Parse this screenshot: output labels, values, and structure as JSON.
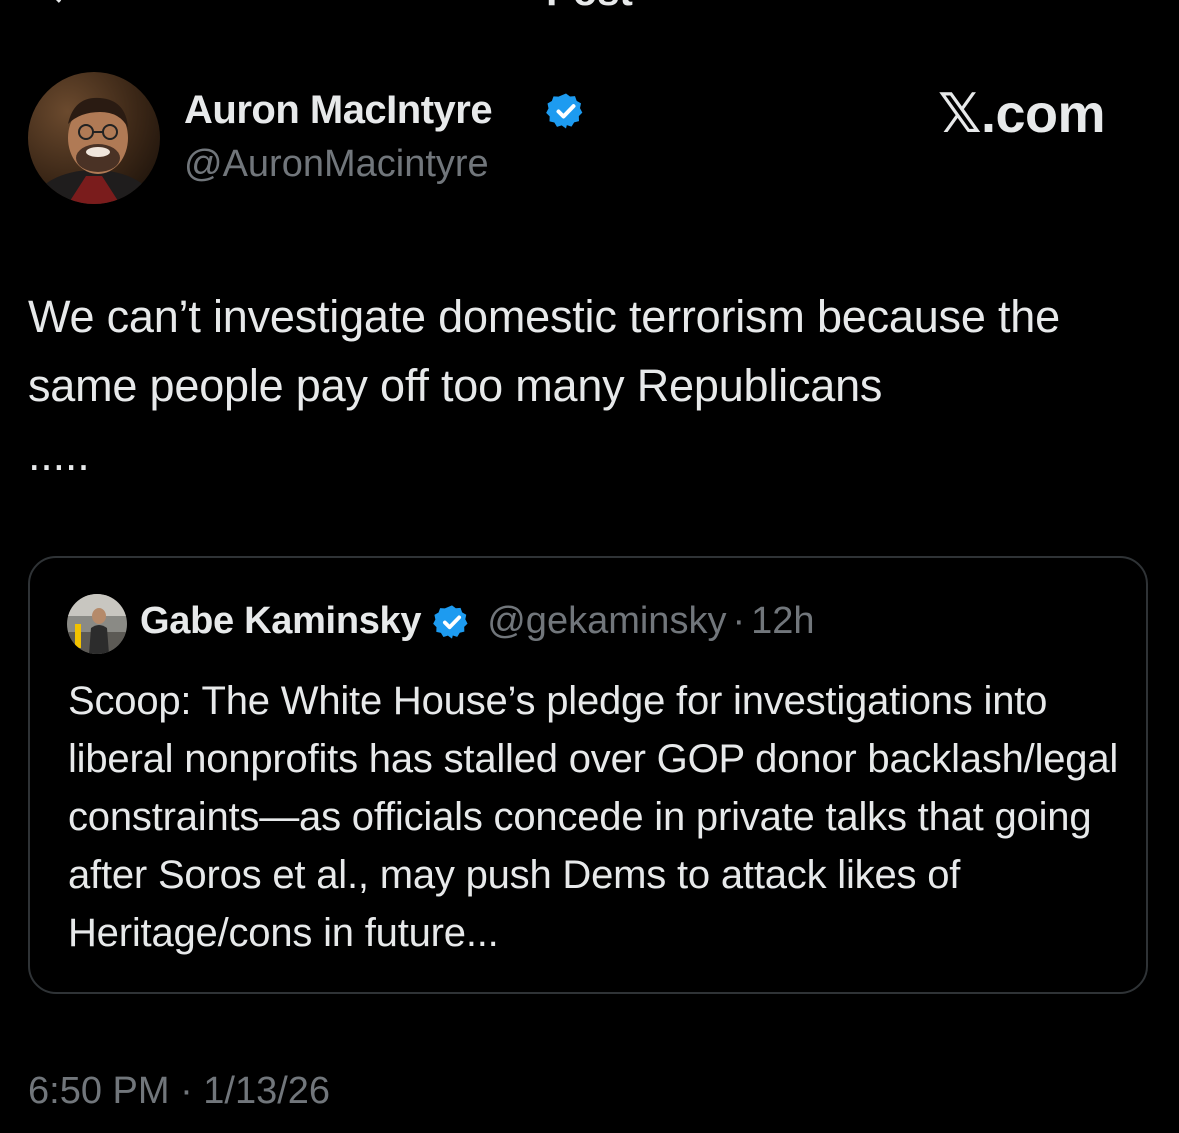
{
  "header": {
    "title": "Post",
    "back_icon": "back-arrow-icon"
  },
  "post": {
    "author_name": "Auron MacIntyre",
    "author_handle": "@AuronMacintyre",
    "verified_icon": "verified-badge-icon",
    "text": "We can’t investigate domestic terrorism because the same people pay off too many Republicans\n.....",
    "timestamp": "6:50 PM · 1/13/26"
  },
  "watermark": "𝕏.com",
  "quote": {
    "author_name": "Gabe Kaminsky",
    "author_handle": "@gekaminsky",
    "separator": "·",
    "time": "12h",
    "text": "Scoop: The White House’s pledge for investigations into liberal nonprofits has stalled over GOP donor backlash/legal constraints—as officials concede in private talks that going after Soros et al., may push Dems to attack likes of Heritage/cons in future..."
  },
  "colors": {
    "background": "#000000",
    "text_primary": "#e7e9ea",
    "text_secondary": "#71767b",
    "verified_blue": "#1d9bf0",
    "card_border": "#2f3336"
  }
}
